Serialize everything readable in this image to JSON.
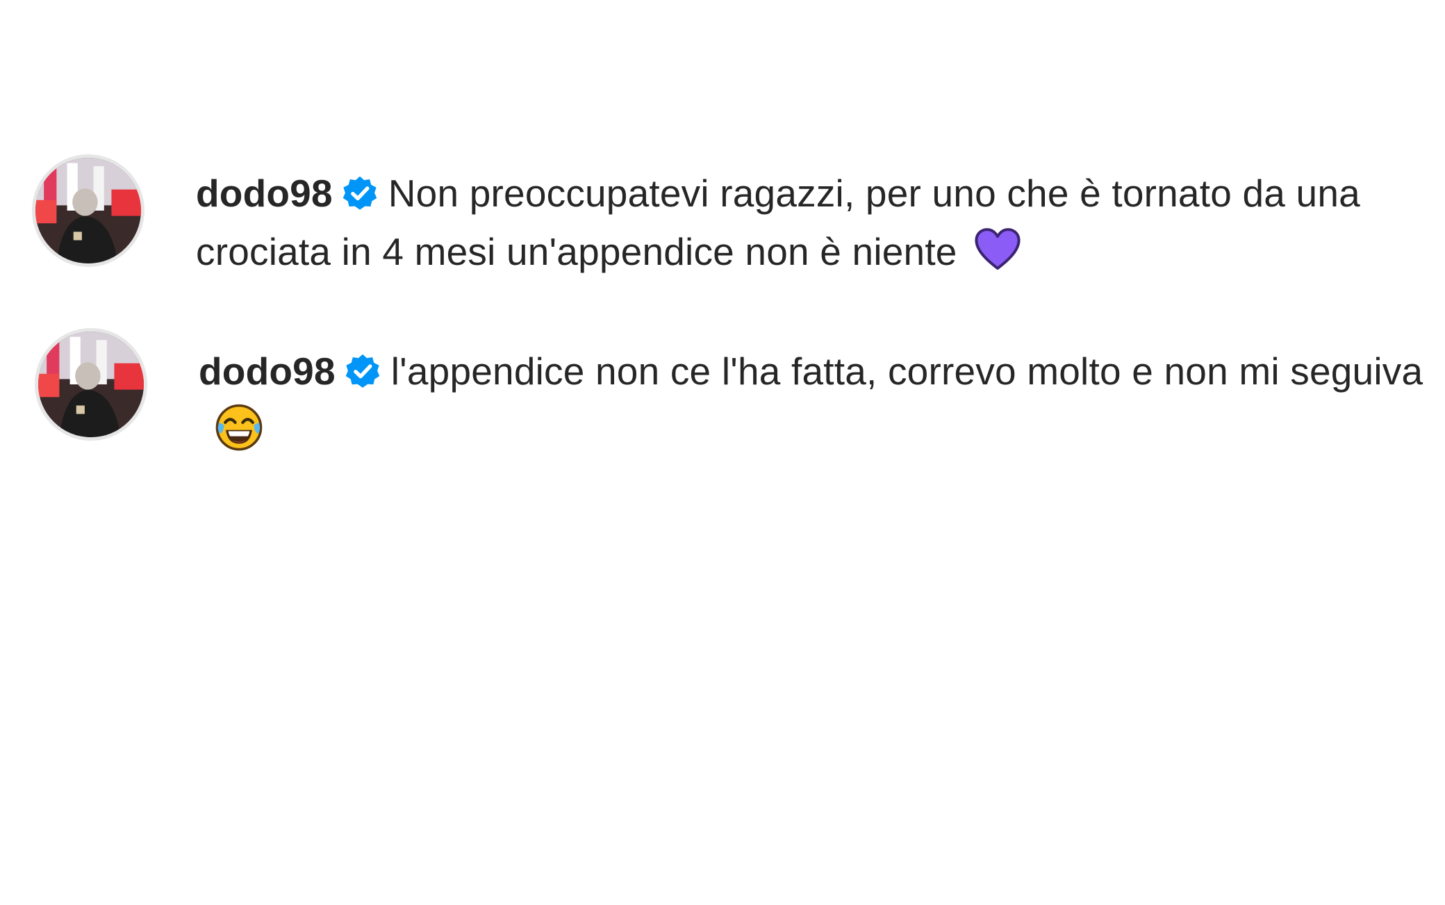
{
  "comments": [
    {
      "username": "dodo98",
      "verified": true,
      "text": "Non preoccupatevi ragazzi, per uno che è tornato da una crociata in 4 mesi un'appendice non è niente",
      "emoji": "purple-heart-icon"
    },
    {
      "username": "dodo98",
      "verified": true,
      "text": "l'appendice non ce l'ha fatta, correvo molto e non mi seguiva",
      "emoji": "tears-of-joy-icon"
    }
  ],
  "colors": {
    "text": "#262626",
    "verified_badge": "#0095f6",
    "heart": "#8b5cf6",
    "avatar_ring": "#e6e6e6"
  }
}
